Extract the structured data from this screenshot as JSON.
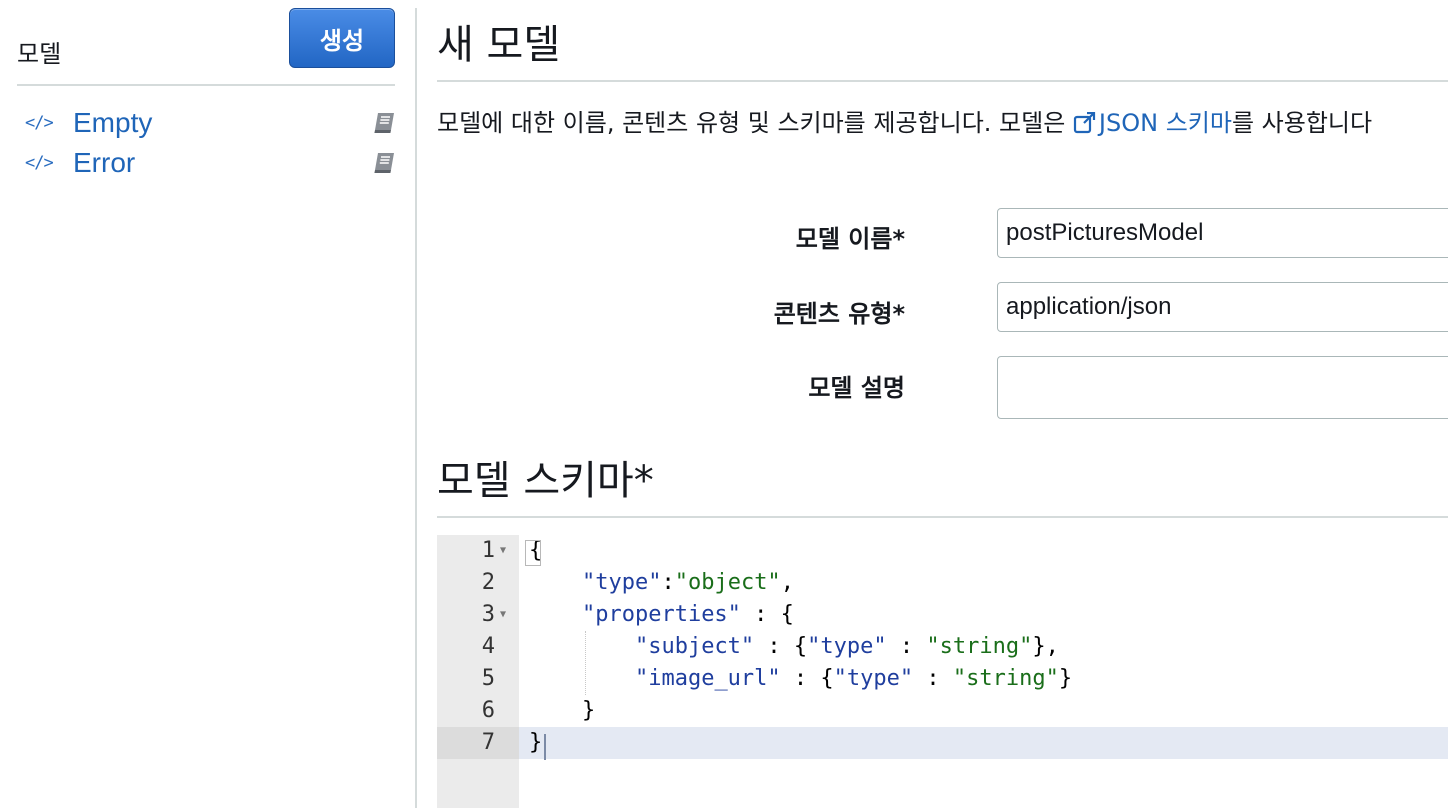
{
  "sidebar": {
    "title": "모델",
    "create_label": "생성",
    "items": [
      {
        "label": "Empty",
        "icon": "code-icon"
      },
      {
        "label": "Error",
        "icon": "code-icon"
      }
    ]
  },
  "main": {
    "title": "새 모델",
    "description_prefix": "모델에 대한 이름, 콘텐츠 유형 및 스키마를 제공합니다. 모델은 ",
    "description_link": "JSON 스키마",
    "description_suffix": "를 사용합니다",
    "form": {
      "name_label": "모델 이름*",
      "name_value": "postPicturesModel",
      "content_type_label": "콘텐츠 유형*",
      "content_type_value": "application/json",
      "description_label": "모델 설명",
      "description_value": ""
    },
    "schema_title": "모델 스키마*",
    "editor": {
      "line_numbers": [
        "1",
        "2",
        "3",
        "4",
        "5",
        "6",
        "7"
      ],
      "lines": [
        "{",
        "    \"type\":\"object\",",
        "    \"properties\" : {",
        "        \"subject\" : {\"type\" : \"string\"},",
        "        \"image_url\" : {\"type\" : \"string\"}",
        "    }",
        "}"
      ]
    }
  },
  "colors": {
    "link": "#1f65b8",
    "button": "#2a6fd0",
    "json_key": "#1f3e9e",
    "json_string": "#1a6e1a"
  }
}
